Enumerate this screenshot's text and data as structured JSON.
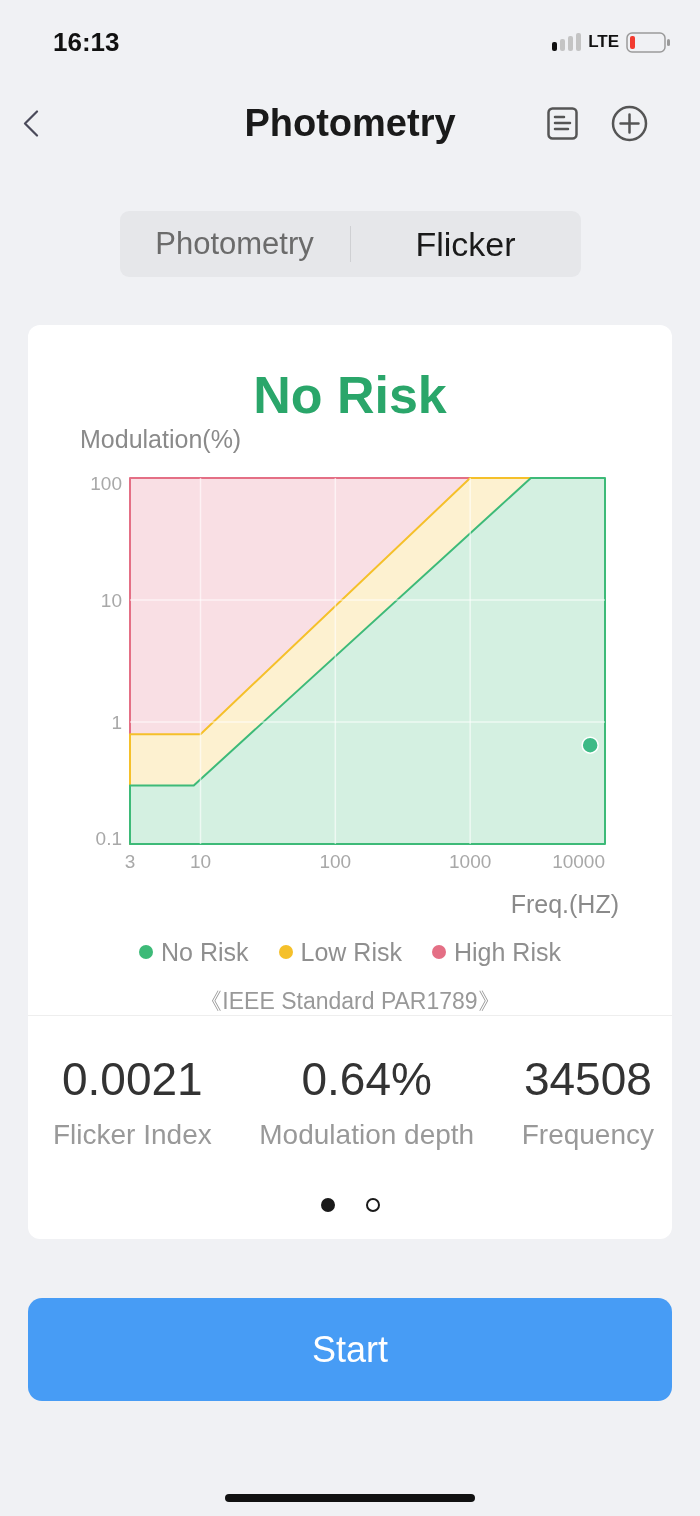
{
  "status_bar": {
    "time": "16:13",
    "network": "LTE"
  },
  "nav": {
    "title": "Photometry"
  },
  "tabs": [
    {
      "label": "Photometry",
      "selected": false
    },
    {
      "label": "Flicker",
      "selected": true
    }
  ],
  "card": {
    "verdict": "No Risk",
    "chart": {
      "ylabel": "Modulation(%)",
      "xlabel": "Freq.(HZ)",
      "y_tick_labels": [
        "100",
        "10",
        "1",
        "0.1"
      ],
      "x_tick_labels": [
        "3",
        "10",
        "100",
        "1000",
        "10000"
      ],
      "zones": [
        {
          "kind": "no_risk",
          "label": "No Risk",
          "color": "#3dba78"
        },
        {
          "kind": "low_risk",
          "label": "Low Risk",
          "color": "#f5c02a"
        },
        {
          "kind": "high_risk",
          "label": "High Risk",
          "color": "#e46f85"
        }
      ]
    },
    "standard": "《IEEE Standard PAR1789》",
    "stats": [
      {
        "value": "0.0021",
        "label": "Flicker Index"
      },
      {
        "value": "0.64%",
        "label": "Modulation depth"
      },
      {
        "value": "34508",
        "label": "Frequency"
      }
    ],
    "pager": [
      {
        "selected": true
      },
      {
        "selected": false
      }
    ]
  },
  "start_button": {
    "label": "Start"
  }
}
